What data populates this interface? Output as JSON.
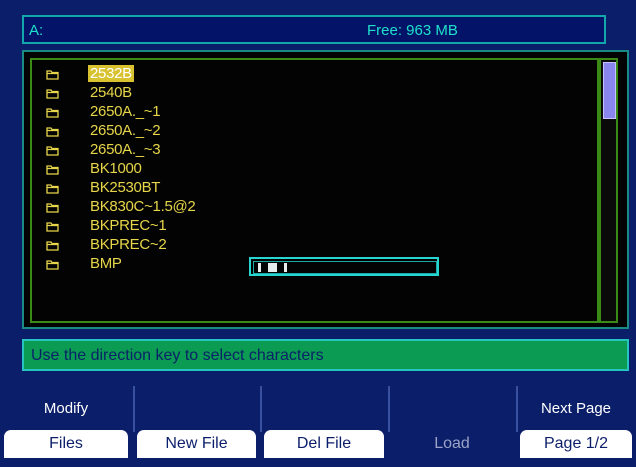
{
  "header": {
    "drive": "A:",
    "free": "Free: 963 MB"
  },
  "files": [
    {
      "name": "2532B",
      "selected": true
    },
    {
      "name": "2540B"
    },
    {
      "name": "2650A._~1"
    },
    {
      "name": "2650A._~2"
    },
    {
      "name": "2650A._~3"
    },
    {
      "name": "BK1000"
    },
    {
      "name": "BK2530BT"
    },
    {
      "name": "BK830C~1.5@2"
    },
    {
      "name": "BKPREC~1"
    },
    {
      "name": "BKPREC~2"
    },
    {
      "name": "BMP"
    }
  ],
  "status": {
    "message": "Use the direction key to select characters"
  },
  "softkeys": [
    {
      "top": "Modify",
      "label": "Files"
    },
    {
      "top": "",
      "label": "New File"
    },
    {
      "top": "",
      "label": "Del File"
    },
    {
      "top": "",
      "label": "Load",
      "disabled": true
    },
    {
      "top": "Next Page",
      "label": "Page 1/2"
    }
  ],
  "colors": {
    "background": "#0b1e6a",
    "file_text": "#e7d64a",
    "status_bg": "#0c9b52",
    "accent": "#26d7d1"
  },
  "icons": {
    "folder": "folder-icon"
  }
}
